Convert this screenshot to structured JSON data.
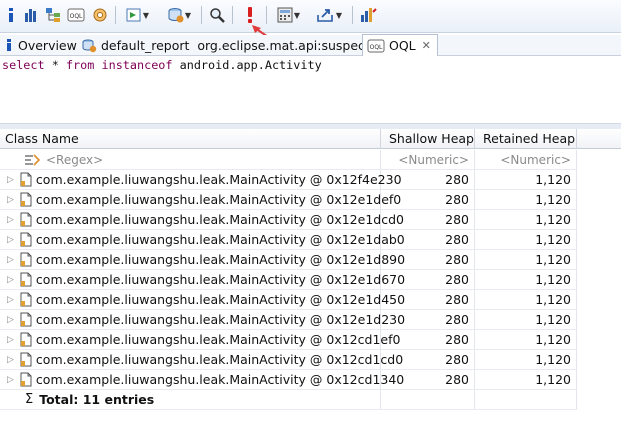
{
  "toolbar": {
    "buttons": [
      {
        "name": "info-icon"
      },
      {
        "name": "histogram-icon"
      },
      {
        "name": "dominator-tree-icon"
      },
      {
        "name": "oql-icon",
        "label": "OQL"
      },
      {
        "name": "heap-dump-overview-icon"
      },
      {
        "name": "run-reports-icon"
      },
      {
        "name": "query-browser-icon"
      },
      {
        "name": "search-icon"
      },
      {
        "name": "execute-query-icon"
      },
      {
        "name": "calculator-icon"
      },
      {
        "name": "export-icon"
      },
      {
        "name": "find-leaks-icon"
      }
    ]
  },
  "tabs": [
    {
      "label": "Overview",
      "icon": "info-icon"
    },
    {
      "label": "default_report  org.eclipse.mat.api:suspects",
      "icon": "report-icon"
    },
    {
      "label": "OQL",
      "icon": "oql-icon",
      "active": true
    }
  ],
  "query": {
    "select": "select",
    "star": "*",
    "from": "from",
    "instanceof": "instanceof",
    "class": "android.app.Activity"
  },
  "table": {
    "columns": [
      "Class Name",
      "Shallow Heap",
      "Retained Heap"
    ],
    "filter": {
      "name": "<Regex>",
      "shallow": "<Numeric>",
      "retained": "<Numeric>"
    },
    "rows": [
      {
        "name": "com.example.liuwangshu.leak.MainActivity @ 0x12f4e230",
        "shallow": "280",
        "retained": "1,120"
      },
      {
        "name": "com.example.liuwangshu.leak.MainActivity @ 0x12e1def0",
        "shallow": "280",
        "retained": "1,120"
      },
      {
        "name": "com.example.liuwangshu.leak.MainActivity @ 0x12e1dcd0",
        "shallow": "280",
        "retained": "1,120"
      },
      {
        "name": "com.example.liuwangshu.leak.MainActivity @ 0x12e1dab0",
        "shallow": "280",
        "retained": "1,120"
      },
      {
        "name": "com.example.liuwangshu.leak.MainActivity @ 0x12e1d890",
        "shallow": "280",
        "retained": "1,120"
      },
      {
        "name": "com.example.liuwangshu.leak.MainActivity @ 0x12e1d670",
        "shallow": "280",
        "retained": "1,120"
      },
      {
        "name": "com.example.liuwangshu.leak.MainActivity @ 0x12e1d450",
        "shallow": "280",
        "retained": "1,120"
      },
      {
        "name": "com.example.liuwangshu.leak.MainActivity @ 0x12e1d230",
        "shallow": "280",
        "retained": "1,120"
      },
      {
        "name": "com.example.liuwangshu.leak.MainActivity @ 0x12cd1ef0",
        "shallow": "280",
        "retained": "1,120"
      },
      {
        "name": "com.example.liuwangshu.leak.MainActivity @ 0x12cd1cd0",
        "shallow": "280",
        "retained": "1,120"
      },
      {
        "name": "com.example.liuwangshu.leak.MainActivity @ 0x12cd1340",
        "shallow": "280",
        "retained": "1,120"
      }
    ],
    "total": "Total: 11 entries",
    "total_symbol": "Σ"
  },
  "colors": {
    "accent": "#d81e1e",
    "keyword": "#7f0055",
    "toolbar_bg": "#eaf0f8"
  }
}
